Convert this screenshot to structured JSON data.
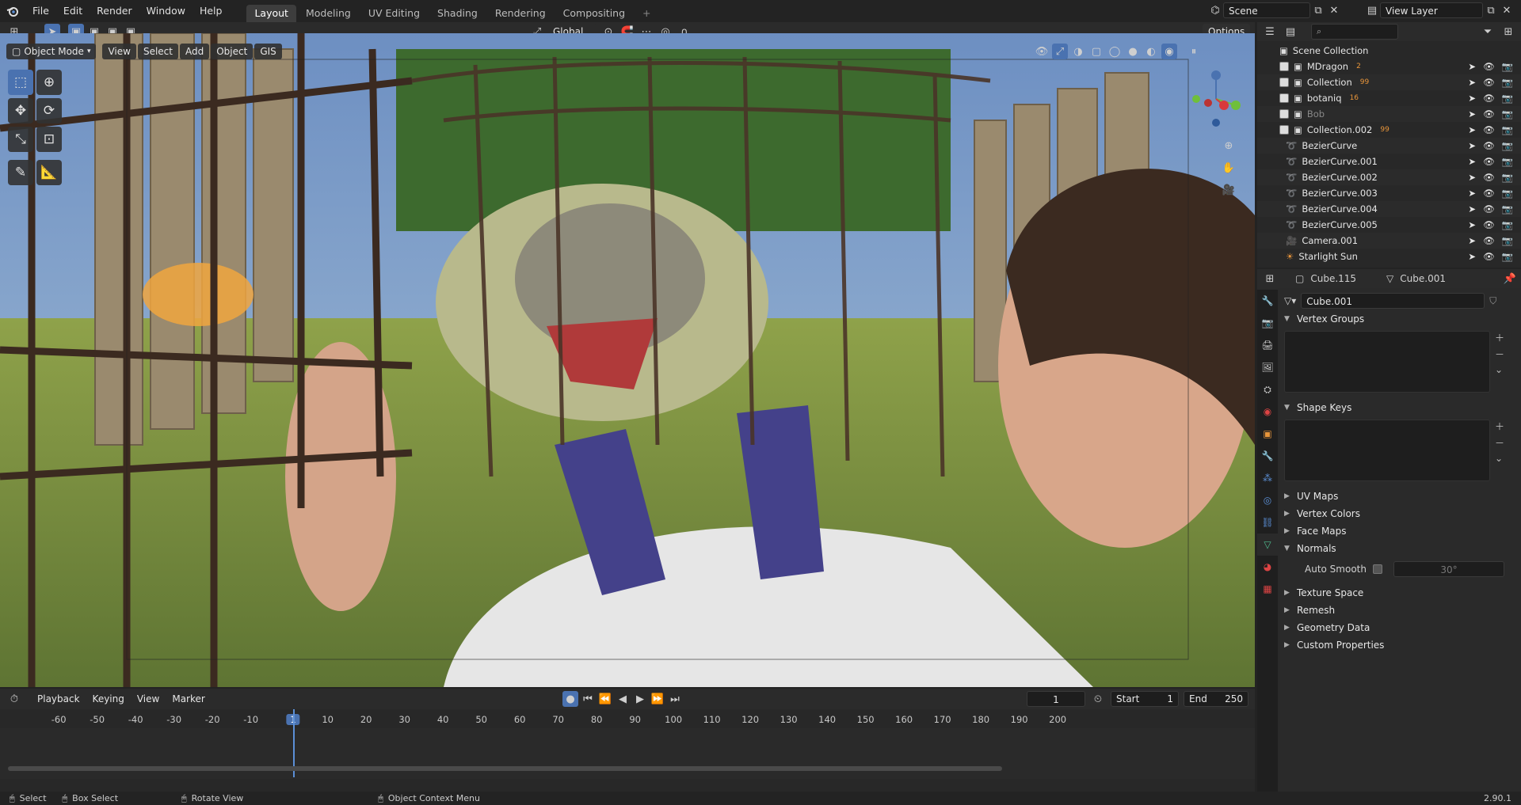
{
  "topbar": {
    "menus": [
      "File",
      "Edit",
      "Render",
      "Window",
      "Help"
    ],
    "workspaces": [
      "Layout",
      "Modeling",
      "UV Editing",
      "Shading",
      "Rendering",
      "Compositing"
    ],
    "active_workspace": "Layout",
    "add_tab": "+",
    "scene_label": "Scene",
    "view_layer_label": "View Layer"
  },
  "tool_header": {
    "transform_orientation": "Global",
    "options_label": "Options"
  },
  "viewport_header": {
    "mode": "Object Mode",
    "menus": [
      "View",
      "Select",
      "Add",
      "Object",
      "GIS"
    ]
  },
  "outliner": {
    "search_placeholder": "",
    "root": "Scene Collection",
    "items": [
      {
        "name": "MDragon",
        "type": "collection",
        "badge": "2"
      },
      {
        "name": "Collection",
        "type": "collection",
        "badge": "99"
      },
      {
        "name": "botaniq",
        "type": "collection",
        "badge": "16"
      },
      {
        "name": "Bob",
        "type": "collection",
        "badge": ""
      },
      {
        "name": "Collection.002",
        "type": "collection",
        "badge": "99"
      },
      {
        "name": "BezierCurve",
        "type": "curve",
        "badge": ""
      },
      {
        "name": "BezierCurve.001",
        "type": "curve",
        "badge": ""
      },
      {
        "name": "BezierCurve.002",
        "type": "curve",
        "badge": ""
      },
      {
        "name": "BezierCurve.003",
        "type": "curve",
        "badge": ""
      },
      {
        "name": "BezierCurve.004",
        "type": "curve",
        "badge": ""
      },
      {
        "name": "BezierCurve.005",
        "type": "curve",
        "badge": ""
      },
      {
        "name": "Camera.001",
        "type": "camera",
        "badge": ""
      },
      {
        "name": "Starlight Sun",
        "type": "light",
        "badge": ""
      }
    ]
  },
  "properties": {
    "object_name": "Cube.115",
    "data_name": "Cube.001",
    "mesh_field": "Cube.001",
    "panels": [
      {
        "label": "Vertex Groups",
        "open": true
      },
      {
        "label": "Shape Keys",
        "open": true
      },
      {
        "label": "UV Maps",
        "open": false
      },
      {
        "label": "Vertex Colors",
        "open": false
      },
      {
        "label": "Face Maps",
        "open": false
      },
      {
        "label": "Normals",
        "open": true
      },
      {
        "label": "Texture Space",
        "open": false
      },
      {
        "label": "Remesh",
        "open": false
      },
      {
        "label": "Geometry Data",
        "open": false
      },
      {
        "label": "Custom Properties",
        "open": false
      }
    ],
    "auto_smooth_label": "Auto Smooth",
    "auto_smooth_angle": "30°"
  },
  "timeline": {
    "menus": [
      "Playback",
      "Keying",
      "View",
      "Marker"
    ],
    "current_frame": "1",
    "start_label": "Start",
    "start_value": "1",
    "end_label": "End",
    "end_value": "250",
    "ticks": [
      "-60",
      "-50",
      "-40",
      "-30",
      "-20",
      "-10",
      "1",
      "10",
      "20",
      "30",
      "40",
      "50",
      "60",
      "70",
      "80",
      "90",
      "100",
      "110",
      "120",
      "130",
      "140",
      "150",
      "160",
      "170",
      "180",
      "190",
      "200"
    ]
  },
  "statusbar": {
    "select": "Select",
    "box_select": "Box Select",
    "rotate_view": "Rotate View",
    "context_menu": "Object Context Menu",
    "version": "2.90.1"
  },
  "colors": {
    "accent": "#4a72b0",
    "orange": "#e8953a",
    "green": "#4fbd8f"
  }
}
